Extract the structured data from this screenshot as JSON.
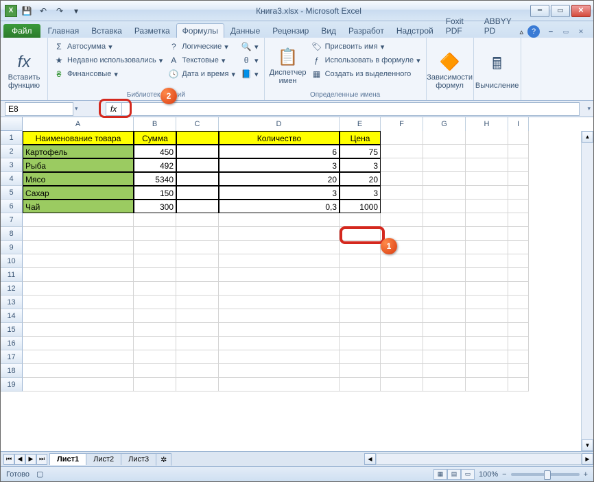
{
  "title": "Книга3.xlsx - Microsoft Excel",
  "qat": {
    "save": "💾",
    "undo": "↶",
    "redo": "↷"
  },
  "file_tab": "Файл",
  "tabs": [
    "Главная",
    "Вставка",
    "Разметка",
    "Формулы",
    "Данные",
    "Рецензир",
    "Вид",
    "Разработ",
    "Надстрой",
    "Foxit PDF",
    "ABBYY PD"
  ],
  "active_tab_index": 3,
  "ribbon": {
    "insert_fn": {
      "label": "Вставить\nфункцию",
      "icon": "fx"
    },
    "lib": {
      "autosum": "Автосумма",
      "recent": "Недавно использовались",
      "financial": "Финансовые",
      "logical": "Логические",
      "text": "Текстовые",
      "date": "Дата и время",
      "group_label": "Библиотека",
      "callout_badge": "2"
    },
    "names": {
      "manager": "Диспетчер\nимен",
      "assign": "Присвоить имя",
      "use": "Использовать в формуле",
      "create": "Создать из выделенного",
      "group_label": "Определенные имена"
    },
    "deps": {
      "label": "Зависимости\nформул"
    },
    "calc": {
      "label": "Вычисление"
    }
  },
  "name_box": "E8",
  "fx_label": "fx",
  "columns": [
    {
      "l": "A",
      "w": 162
    },
    {
      "l": "B",
      "w": 62
    },
    {
      "l": "C",
      "w": 62
    },
    {
      "l": "D",
      "w": 176
    },
    {
      "l": "E",
      "w": 60
    },
    {
      "l": "F",
      "w": 62
    },
    {
      "l": "G",
      "w": 62
    },
    {
      "l": "H",
      "w": 62
    },
    {
      "l": "I",
      "w": 30
    }
  ],
  "headers": {
    "name": "Наименование товара",
    "sum": "Сумма",
    "qty": "Количество",
    "price": "Цена"
  },
  "rows": [
    {
      "name": "Картофель",
      "sum": "450",
      "qty": "6",
      "price": "75"
    },
    {
      "name": "Рыба",
      "sum": "492",
      "qty": "3",
      "price": "3"
    },
    {
      "name": "Мясо",
      "sum": "5340",
      "qty": "20",
      "price": "20"
    },
    {
      "name": "Сахар",
      "sum": "150",
      "qty": "3",
      "price": "3"
    },
    {
      "name": "Чай",
      "sum": "300",
      "qty": "0,3",
      "price": "1000"
    }
  ],
  "selected_badge": "1",
  "sheets": [
    "Лист1",
    "Лист2",
    "Лист3"
  ],
  "status": "Готово",
  "zoom": "100%"
}
